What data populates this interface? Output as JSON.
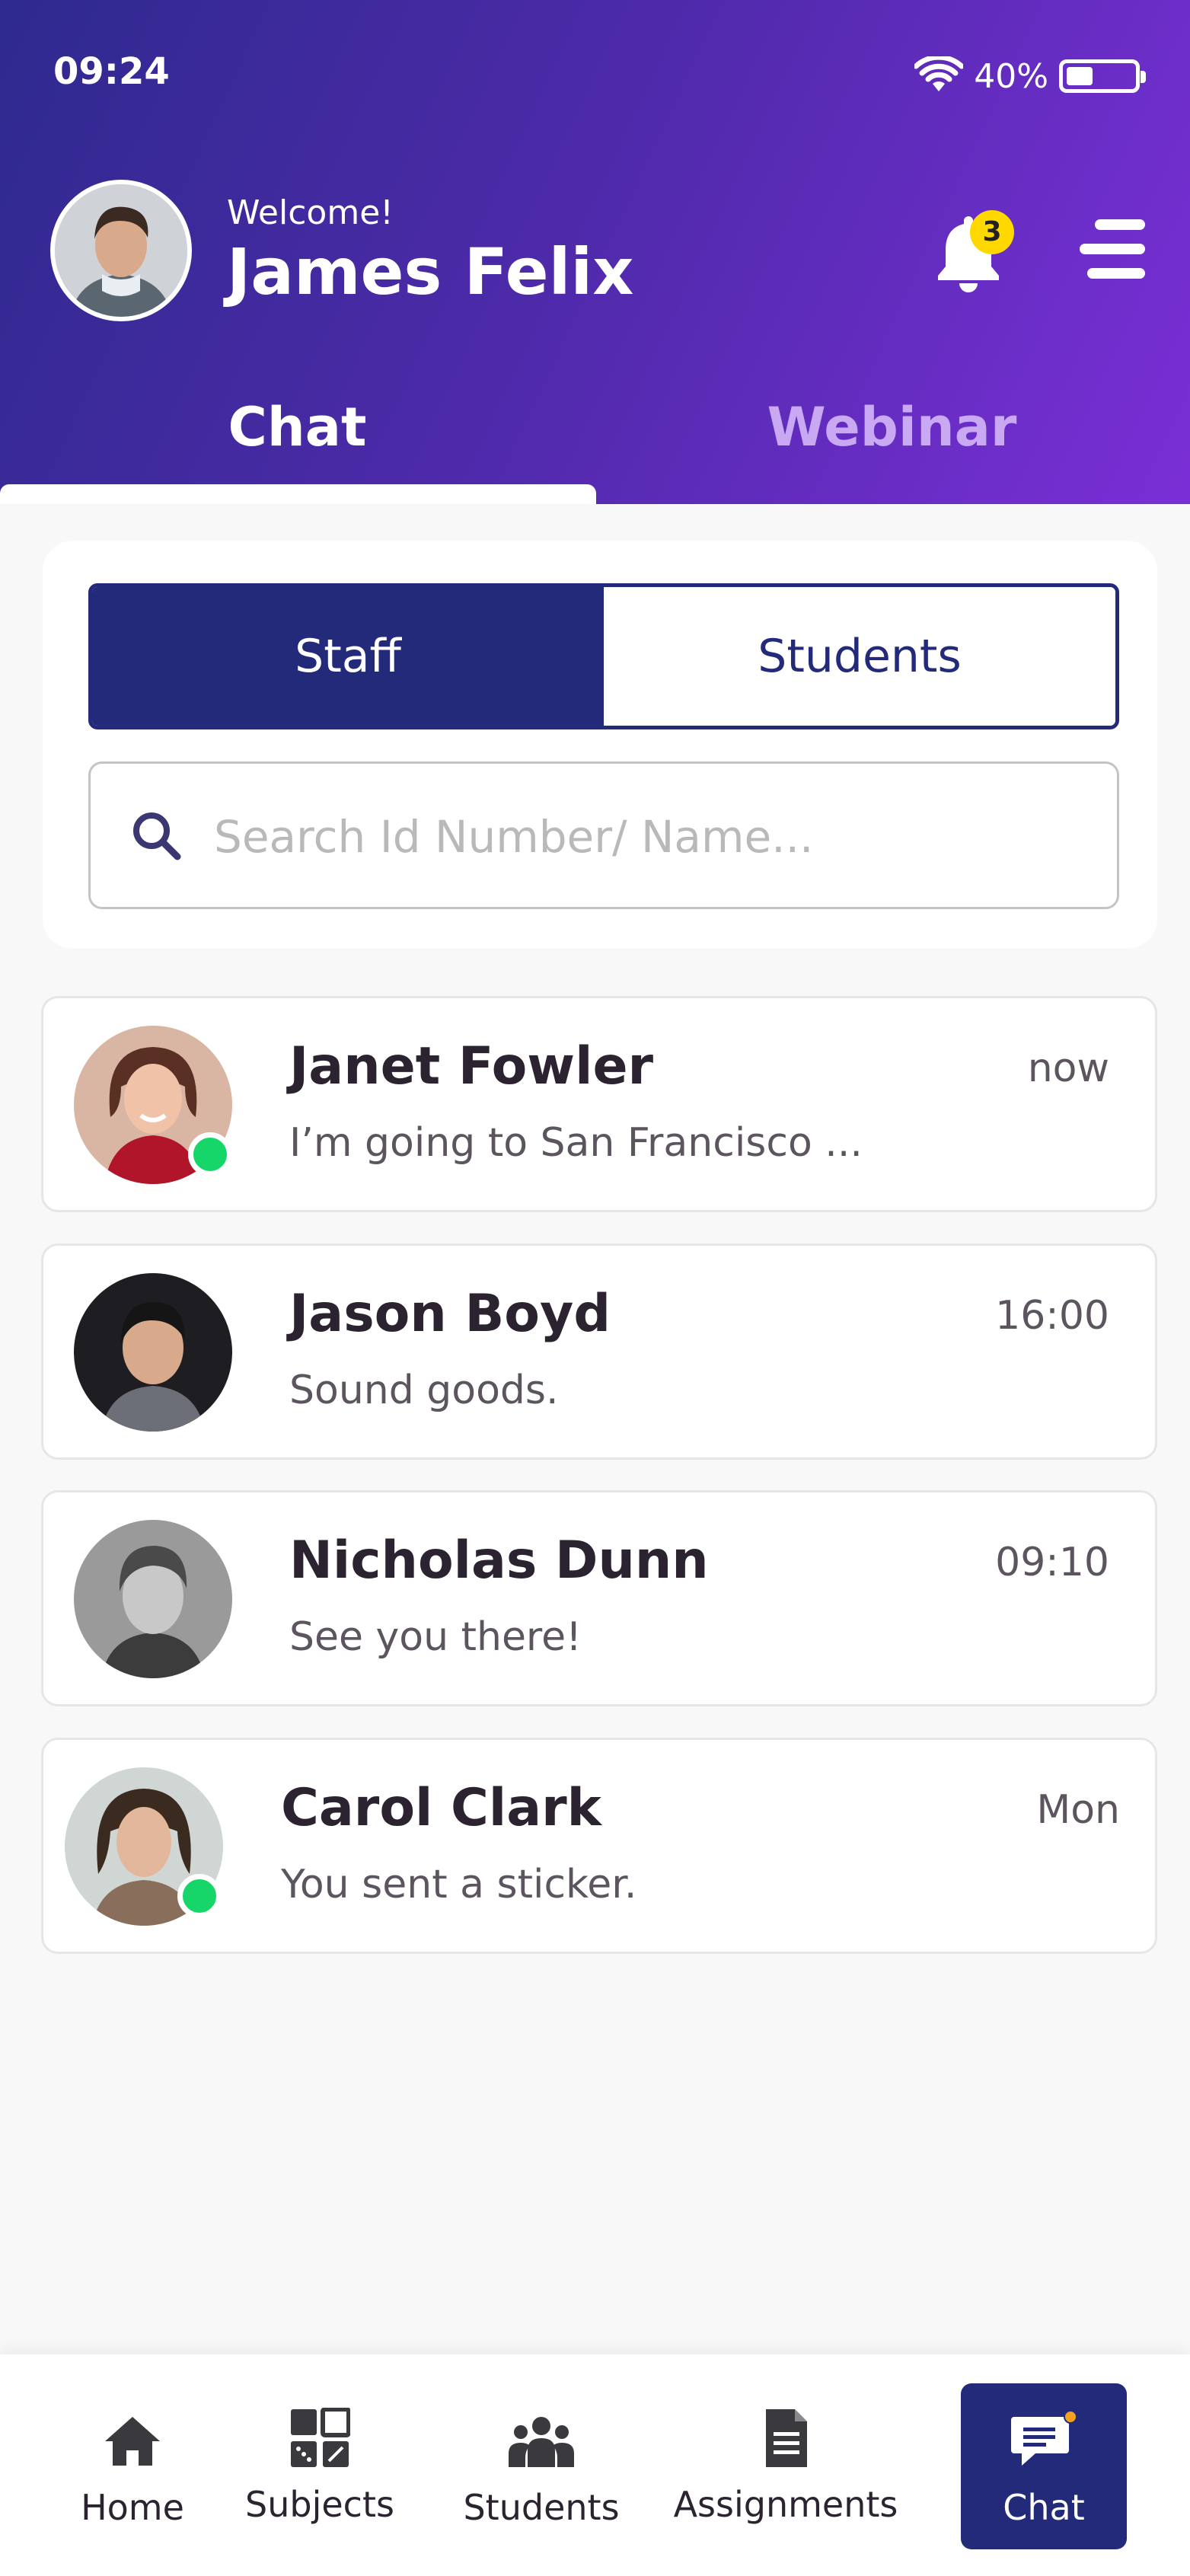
{
  "status": {
    "time": "09:24",
    "battery_text": "40%",
    "battery_level": 0.4
  },
  "header": {
    "welcome": "Welcome!",
    "user_name": "James Felix",
    "notification_count": "3"
  },
  "tabs": [
    {
      "label": "Chat",
      "active": true
    },
    {
      "label": "Webinar",
      "active": false
    }
  ],
  "segment": {
    "staff": "Staff",
    "students": "Students",
    "selected": "Staff"
  },
  "search": {
    "placeholder": "Search Id Number/ Name..."
  },
  "chats": [
    {
      "name": "Janet Fowler",
      "preview": "I’m going to San Francisco ...",
      "time": "now",
      "online": true
    },
    {
      "name": "Jason Boyd",
      "preview": "Sound goods.",
      "time": "16:00",
      "online": false
    },
    {
      "name": "Nicholas Dunn",
      "preview": "See you there!",
      "time": "09:10",
      "online": false
    },
    {
      "name": "Carol Clark",
      "preview": "You sent a sticker.",
      "time": "Mon",
      "online": true
    }
  ],
  "nav": [
    {
      "label": "Home",
      "icon": "home-icon"
    },
    {
      "label": "Subjects",
      "icon": "grid-icon"
    },
    {
      "label": "Students",
      "icon": "group-icon"
    },
    {
      "label": "Assignments",
      "icon": "document-icon"
    },
    {
      "label": "Chat",
      "icon": "chat-bubble-icon",
      "active": true
    }
  ],
  "colors": {
    "brand_dark": "#232a7a",
    "gradient_start": "#2e2a8f",
    "gradient_end": "#7a2fd6",
    "online": "#16d66a",
    "badge": "#ffd800"
  }
}
